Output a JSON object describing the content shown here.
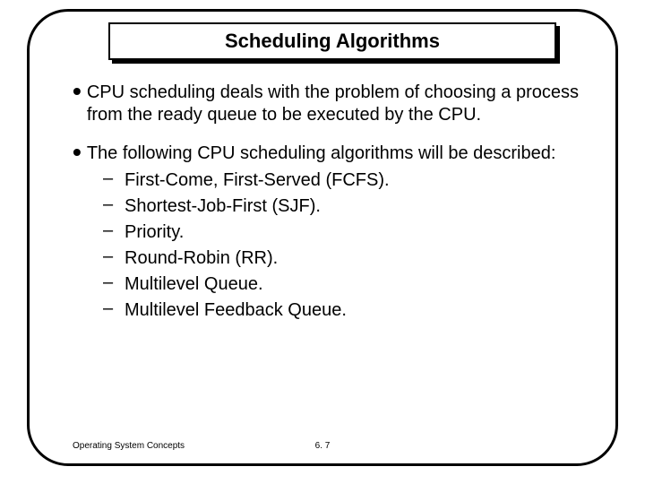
{
  "title": "Scheduling Algorithms",
  "bullets": [
    {
      "text": "CPU scheduling deals with the problem of choosing a process from the ready queue to be executed by the CPU.",
      "subitems": []
    },
    {
      "text": "The following CPU scheduling algorithms will be described:",
      "subitems": [
        "First-Come, First-Served (FCFS).",
        "Shortest-Job-First (SJF).",
        "Priority.",
        "Round-Robin (RR).",
        "Multilevel Queue.",
        "Multilevel Feedback Queue."
      ]
    }
  ],
  "footer": {
    "left": "Operating System Concepts",
    "center": "6. 7"
  }
}
